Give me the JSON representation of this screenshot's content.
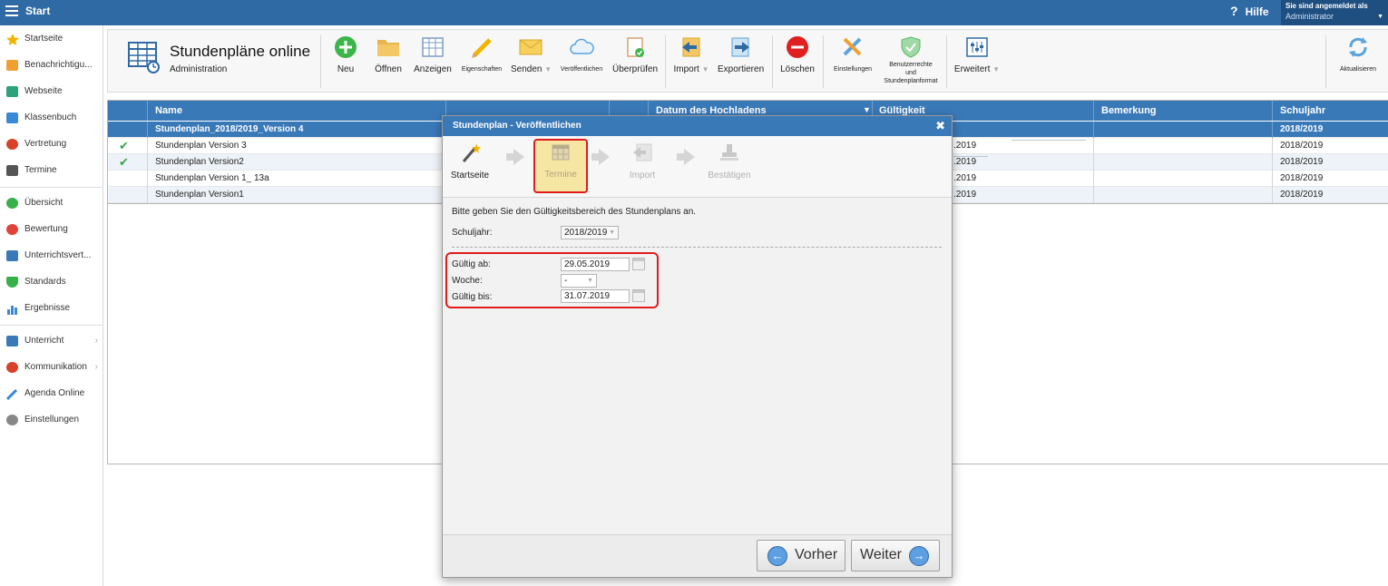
{
  "topbar": {
    "title": "Start",
    "help": "Hilfe",
    "help_icon": "?",
    "user_line1": "Sie sind angemeldet als",
    "user_line2": "Administrator"
  },
  "sidebar": {
    "items": [
      {
        "label": "Startseite",
        "icon": "star-icon",
        "color": "#f0b400"
      },
      {
        "label": "Benachrichtigu...",
        "icon": "mail-icon",
        "color": "#f0a030"
      },
      {
        "label": "Webseite",
        "icon": "home-icon",
        "color": "#2ca37a"
      },
      {
        "label": "Klassenbuch",
        "icon": "book-icon",
        "color": "#3a89d6"
      },
      {
        "label": "Vertretung",
        "icon": "person-icon",
        "color": "#d9412b"
      },
      {
        "label": "Termine",
        "icon": "calendar-icon",
        "color": "#555555"
      },
      {
        "label": "Übersicht",
        "icon": "check-circle-icon",
        "color": "#37b04a"
      },
      {
        "label": "Bewertung",
        "icon": "rating-icon",
        "color": "#e0433a"
      },
      {
        "label": "Unterrichtsvert...",
        "icon": "briefcase-icon",
        "color": "#3a79b8"
      },
      {
        "label": "Standards",
        "icon": "shield-icon",
        "color": "#37b04a"
      },
      {
        "label": "Ergebnisse",
        "icon": "bar-chart-icon",
        "color": "#3a89d6"
      },
      {
        "label": "Unterricht",
        "icon": "folder-icon",
        "color": "#3a79b8"
      },
      {
        "label": "Kommunikation",
        "icon": "chat-icon",
        "color": "#d9412b"
      },
      {
        "label": "Agenda Online",
        "icon": "pen-icon",
        "color": "#3a89d6"
      },
      {
        "label": "Einstellungen",
        "icon": "gear-icon",
        "color": "#888888"
      }
    ]
  },
  "toolbar": {
    "title": "Stundenpläne online",
    "subtitle": "Administration",
    "buttons": {
      "neu": "Neu",
      "oeffnen": "Öffnen",
      "anzeigen": "Anzeigen",
      "eigenschaften": "Eigenschaften",
      "senden": "Senden",
      "veroeffentlichen": "Veröffentlichen",
      "ueberpruefen": "Überprüfen",
      "import": "Import",
      "exportieren": "Exportieren",
      "loeschen": "Löschen",
      "einstellungen": "Einstellungen",
      "benutzerrechte_1": "Benutzerrechte",
      "benutzerrechte_2": "und",
      "benutzerrechte_3": "Stundenplanformat",
      "erweitert": "Erweitert",
      "aktualisieren": "Aktualisieren"
    },
    "dropdown_glyph": "▼"
  },
  "table": {
    "columns": {
      "name": "Name",
      "datum": "Datum des Hochladens",
      "gueltigkeit": "Gültigkeit",
      "bemerkung": "Bemerkung",
      "schuljahr": "Schuljahr"
    },
    "sort_glyph": "▼",
    "rows": [
      {
        "name": "Stundenplan_2018/2019_Version 4",
        "gueltigkeit": "",
        "schuljahr": "2018/2019",
        "checked": false
      },
      {
        "name": "Stundenplan Version 3",
        "gueltigkeit": ".2019",
        "schuljahr": "2018/2019",
        "checked": true
      },
      {
        "name": "Stundenplan Version2",
        "gueltigkeit": ".2019",
        "schuljahr": "2018/2019",
        "checked": true
      },
      {
        "name": "Stundenplan Version 1_ 13a",
        "gueltigkeit": ".2019",
        "schuljahr": "2018/2019",
        "checked": false
      },
      {
        "name": "Stundenplan Version1",
        "gueltigkeit": ".2019",
        "schuljahr": "2018/2019",
        "checked": false
      }
    ],
    "check_glyph": "✔"
  },
  "dialog": {
    "title": "Stundenplan - Veröffentlichen",
    "close_glyph": "✖",
    "steps": {
      "startseite": "Startseite",
      "termine": "Termine",
      "import": "Import",
      "bestaetigen": "Bestätigen"
    },
    "instruction": "Bitte geben Sie den Gültigkeitsbereich des Stundenplans an.",
    "schuljahr_label": "Schuljahr:",
    "schuljahr_value": "2018/2019",
    "gueltig_ab_label": "Gültig ab:",
    "gueltig_ab_value": "29.05.2019",
    "woche_label": "Woche:",
    "woche_value": "-",
    "gueltig_bis_label": "Gültig bis:",
    "gueltig_bis_value": "31.07.2019",
    "prev_button": "Vorher",
    "next_button": "Weiter",
    "prev_glyph": "←",
    "next_glyph": "→"
  },
  "colors": {
    "primary": "#3a79b8",
    "topbar": "#2f6aa5",
    "highlight": "#e01b1b",
    "active_step": "#f6e6a4"
  }
}
